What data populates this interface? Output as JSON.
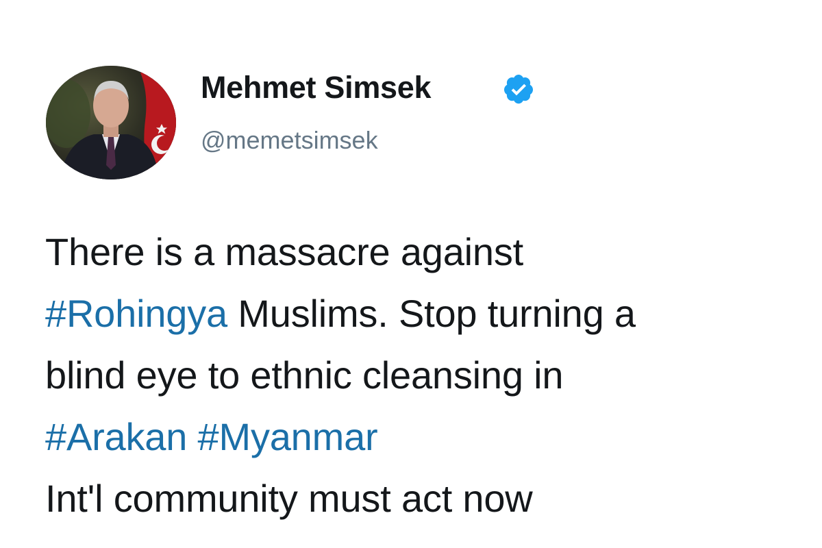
{
  "author": {
    "display_name": "Mehmet Simsek",
    "handle": "@memetsimsek",
    "verified_icon": "verified-badge-icon",
    "verified_color": "#1da1f2"
  },
  "tweet": {
    "line1": "There is a massacre against",
    "line2_hashtag": "#Rohingya",
    "line2_text": " Muslims. Stop turning a",
    "line3": "blind eye to ethnic cleansing in",
    "line4_hashtag1": "#Arakan",
    "line4_space": " ",
    "line4_hashtag2": "#Myanmar",
    "line5": "Int'l community must act now"
  },
  "colors": {
    "text": "#14171a",
    "handle": "#657786",
    "hashtag": "#1b6fa8"
  }
}
